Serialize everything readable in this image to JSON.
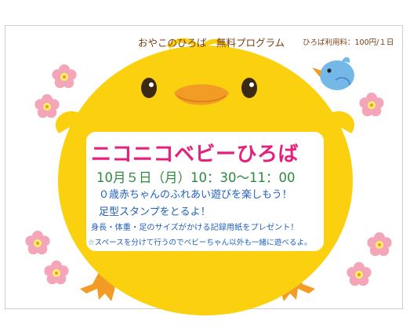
{
  "header": {
    "title": "おやこのひろば　無料プログラム",
    "fee": "ひろば利用料：100円/１日"
  },
  "event": {
    "title": "ニコニコベビーひろば",
    "date": "10月５日（月）10：30～11：00",
    "lines": [
      "０歳赤ちゃんのふれあい遊びを楽しもう！",
      "足型スタンプをとるよ！",
      "身長・体重・足のサイズがかける記録用紙をプレゼント！",
      "☆スペースを分けて行うのでベビーちゃん以外も一緒に遊べるよ。"
    ]
  },
  "colors": {
    "chick": "#fbd10f",
    "beak": "#f39c25",
    "title": "#e5207c",
    "date": "#2b8a3e",
    "body_text": "#1f5fc0",
    "flower": "#f4a6b8",
    "bird": "#74b8e8"
  },
  "illustrations": [
    "chick-illustration",
    "flower-icon",
    "blue-bird-icon"
  ]
}
